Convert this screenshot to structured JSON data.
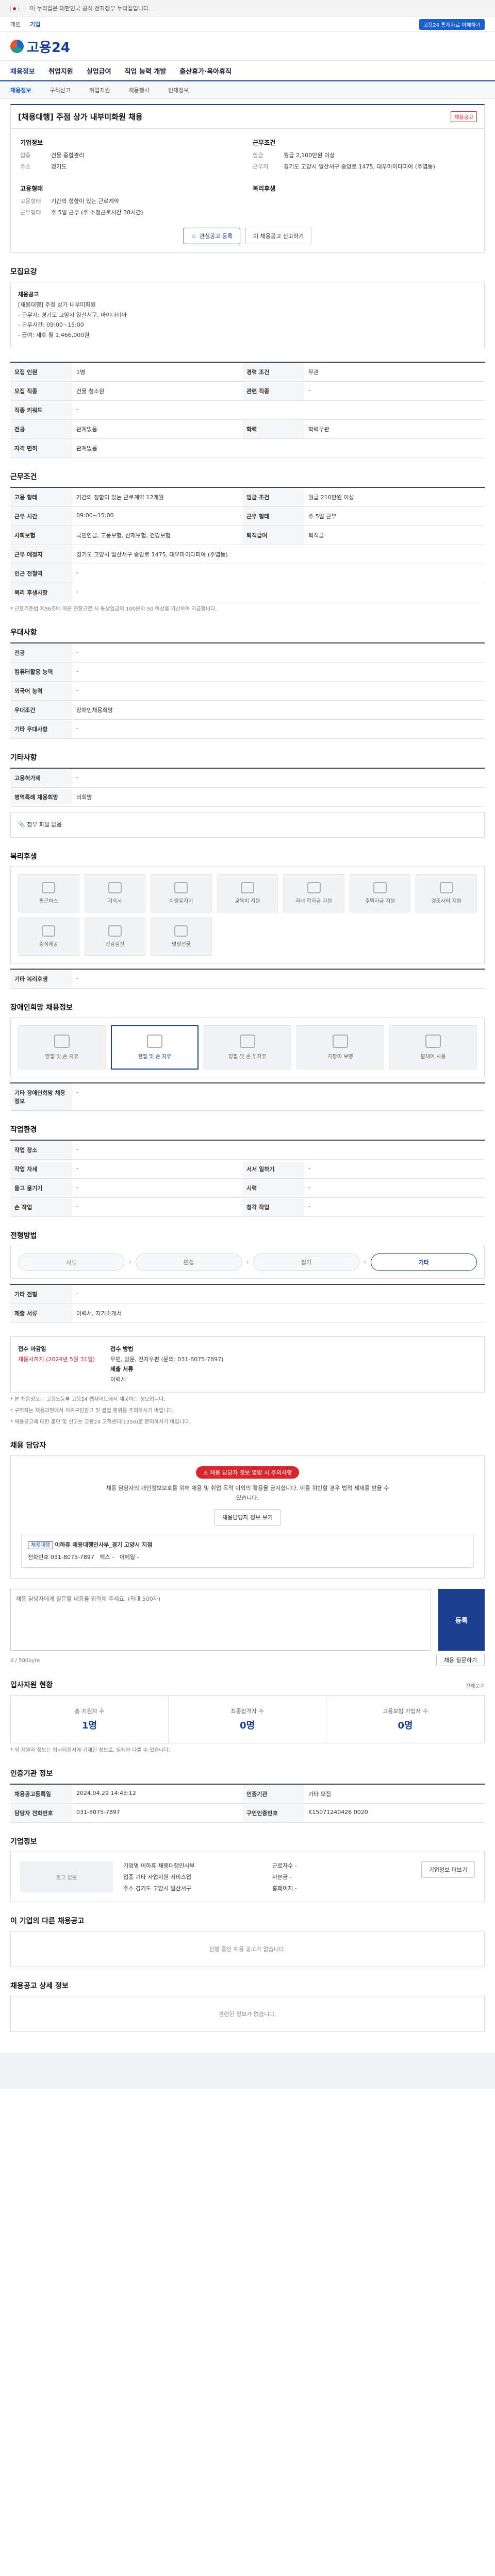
{
  "topbar": {
    "notice": "이 누리집은 대한민국 공식 전자정부 누리집입니다.",
    "links": [
      "개인",
      "기업"
    ],
    "top_btn": "고용24 통계자료 이해하기"
  },
  "header": {
    "logo": "고용24"
  },
  "gnb": {
    "items": [
      "채용정보",
      "취업지원",
      "실업급여",
      "직업 능력 개발",
      "출산휴가·육아휴직"
    ]
  },
  "subnav": [
    "채용정보",
    "구직신고",
    "취업지원",
    "채용행사",
    "인재정보"
  ],
  "title": {
    "text": "[채용대행] 주점 상가 내부미화원 채용",
    "tag": "채용공고"
  },
  "summary": {
    "company_h": "기업정보",
    "work_h": "근무조건",
    "hire_h": "고용형태",
    "support_h": "복리후생",
    "company": [
      {
        "k": "업종",
        "v": "건물 종합관리"
      },
      {
        "k": "주소",
        "v": "경기도"
      }
    ],
    "work": [
      {
        "k": "임금",
        "v": "월급 2,100만원 이상"
      },
      {
        "k": "근무지",
        "v": "경기도 고양시 일산서구 중앙로 1475, 대우마이다피아 (주엽동)"
      }
    ],
    "hire": [
      {
        "k": "고용형태",
        "v": "기간의 정함이 있는 근로계약"
      },
      {
        "k": "근무형태",
        "v": "주 5일 근무 (주 소정근로시간 38시간)"
      }
    ]
  },
  "buttons": {
    "apply": "관심공고 등록",
    "report": "이 채용공고 신고하기"
  },
  "recruit": {
    "title": "모집요강",
    "lines": [
      "채용공고",
      "[채용대행] 주점 상가 내부미화원",
      "- 근무지: 경기도 고양시 일산서구, 마이다피아",
      "- 근무시간: 09:00~15:00",
      "- 급여: 세후 월 1,466,000원"
    ]
  },
  "info": {
    "title": "모집요강",
    "rows": [
      {
        "k1": "모집 인원",
        "v1": "1명",
        "k2": "경력 조건",
        "v2": "무관"
      },
      {
        "k1": "모집 직종",
        "v1": "건물 청소원",
        "k2": "관련 직종",
        "v2": "-"
      },
      {
        "k1": "직종 키워드",
        "v1": "-",
        "k2": "",
        "v2": ""
      },
      {
        "k1": "전공",
        "v1": "관계없음",
        "k2": "학력",
        "v2": "학력무관"
      },
      {
        "k1": "자격 면허",
        "v1": "관계없음",
        "k2": "",
        "v2": ""
      }
    ]
  },
  "conditions": {
    "title": "근무조건",
    "rows": [
      {
        "k1": "고용 형태",
        "v1": "기간의 정함이 있는 근로계약 12개월",
        "k2": "임금 조건",
        "v2": "월급 210만원 이상"
      },
      {
        "k1": "근무 시간",
        "v1": "09:00~15:00",
        "k2": "근무 형태",
        "v2": "주 5일 근무"
      },
      {
        "k1": "사회보험",
        "v1": "국민연금, 고용보험, 산재보험, 건강보험",
        "k2": "퇴직급여",
        "v2": "퇴직금"
      },
      {
        "k1": "근무 예정지",
        "v1": "경기도 고양시 일산서구 중앙로 1475, 대우마이다피아 (주엽동)",
        "k2": "",
        "v2": ""
      },
      {
        "k1": "인근 전철역",
        "v1": "-",
        "k2": "",
        "v2": ""
      },
      {
        "k1": "복리 후생사항",
        "v1": "-",
        "k2": "",
        "v2": ""
      }
    ],
    "note": "* 근로기준법 제56조에 따른 연장근로 시 통상임금의 100분의 50 이상을 가산하여 지급합니다."
  },
  "special": {
    "title": "우대사항",
    "rows": [
      {
        "k": "전공",
        "v": "-"
      },
      {
        "k": "컴퓨터활용 능력",
        "v": "-"
      },
      {
        "k": "외국어 능력",
        "v": "-"
      },
      {
        "k": "우대조건",
        "v": "장애인채용희망"
      },
      {
        "k": "기타 우대사항",
        "v": "-"
      }
    ]
  },
  "etc": {
    "title": "기타사항",
    "rows": [
      {
        "k": "고용허가제",
        "v": "-"
      },
      {
        "k": "병역특례 채용희망",
        "v": "비희망"
      }
    ],
    "attach": "첨부 파일 없음"
  },
  "env": {
    "title": "복리후생",
    "items": [
      "통근버스",
      "기숙사",
      "차량유지비",
      "교육비 지원",
      "자녀 학자금 지원",
      "주택자금 지원",
      "경조사비 지원",
      "중식제공",
      "건강검진",
      "명절선물"
    ],
    "etc_k": "기타 복리후생",
    "etc_v": "-"
  },
  "disability": {
    "title": "장애인희망 채용정보",
    "items": [
      "양팔 및 손 자유",
      "한팔 및 손 자유",
      "양팔 및 손 부자유",
      "지팡이 보행",
      "휠체어 사용"
    ],
    "etc_k": "기타 장애인희망 채용정보",
    "etc_v": "-"
  },
  "workenv": {
    "title": "작업환경",
    "rows": [
      {
        "k1": "작업 장소",
        "v1": "-",
        "k2": "",
        "v2": ""
      },
      {
        "k1": "작업 자세",
        "v1": "-",
        "k2": "서서 일하기",
        "v2": "-"
      },
      {
        "k1": "들고 옮기기",
        "v1": "-",
        "k2": "시력",
        "v2": "-"
      },
      {
        "k1": "손 작업",
        "v1": "-",
        "k2": "청각 작업",
        "v2": "-"
      }
    ]
  },
  "process": {
    "title": "전형방법",
    "steps": [
      "서류",
      "면접",
      "필기",
      "기타"
    ],
    "rows": [
      {
        "k": "기타 전형",
        "v": "-"
      },
      {
        "k": "제출 서류",
        "v": "이력서, 자기소개서"
      }
    ]
  },
  "apply": {
    "title": "접수 마감일",
    "deadline": "채용시까지 (2024년 5월 31일)",
    "method_h": "접수 방법",
    "method": "우편, 방문, 전자우편 (문의: 031-8075-7897)",
    "doc_h": "제출 서류",
    "doc": "이력서",
    "notes": [
      "* 본 채용정보는 고용노동부 고용24 웹사이트에서 제공하는 정보입니다.",
      "* 구직자는 채용과정에서 허위구인광고 및 불법 행위를 주의하시기 바랍니다.",
      "* 채용공고에 대한 불만 및 신고는 고용24 고객센터(1350)로 문의하시기 바랍니다."
    ]
  },
  "contact": {
    "title": "채용 담당자",
    "warn": "채용 담당자 정보 열람 시 주의사항",
    "warn_txt": "채용 담당자의 개인정보보호를 위해 채용 및 취업 목적 이외의 활용을 금지합니다. 이를 위반할 경우 법적 제재를 받을 수 있습니다.",
    "view_btn": "채용담당자 정보 보기",
    "card_label": "채용대행",
    "card_name": "이하휴 채용대행인사부_경기 고양시 지점",
    "phone_label": "전화번호",
    "phone": "031-8075-7897",
    "fax_label": "팩스",
    "fax": "-",
    "email_label": "이메일",
    "email": "-"
  },
  "ask": {
    "title": "채용 담당자에게 질문하기",
    "hint": "질문 시 유의사항",
    "placeholder": "채용 담당자에게 질문할 내용을 입력해 주세요. (최대 500자)",
    "counter": "0 / 500byte",
    "send": "등록",
    "more": "채용 질문하기"
  },
  "status": {
    "title": "입사지원 현황",
    "more": "전체보기",
    "stats": [
      {
        "l": "총 지원자 수",
        "n": "1명"
      },
      {
        "l": "최종합격자 수",
        "n": "0명"
      },
      {
        "l": "고용보험 가입자 수",
        "n": "0명"
      }
    ],
    "note": "* 위 지원자 정보는 입사지원서에 기재된 정보로, 실제와 다를 수 있습니다."
  },
  "meta": {
    "title": "인증기관 정보",
    "rows": [
      {
        "k1": "채용공고등록일",
        "v1": "2024.04.29 14:43:12",
        "k2": "인증기관",
        "v2": "기타 모집"
      },
      {
        "k1": "담당자 전화번호",
        "v1": "031-8075-7897",
        "k2": "구인인증번호",
        "v2": "K15071240426 0020"
      }
    ]
  },
  "company": {
    "title": "기업정보",
    "logo_alt": "로고 없음",
    "name_k": "기업명",
    "name_v": "이하휴 채용대행인사부",
    "emp_k": "근로자수",
    "emp_v": "-",
    "ind_k": "업종",
    "ind_v": "기타 사업지원 서비스업",
    "cap_k": "자본금",
    "cap_v": "-",
    "addr_k": "주소",
    "addr_v": "경기도 고양시 일산서구",
    "web_k": "홈페이지",
    "web_v": "-",
    "btn": "기업정보 더보기"
  },
  "other": {
    "title": "이 기업의 다른 채용공고",
    "empty": "진행 중인 채용 공고가 없습니다."
  },
  "similar": {
    "title": "채용공고 상세 정보",
    "empty": "관련된 정보가 없습니다."
  }
}
